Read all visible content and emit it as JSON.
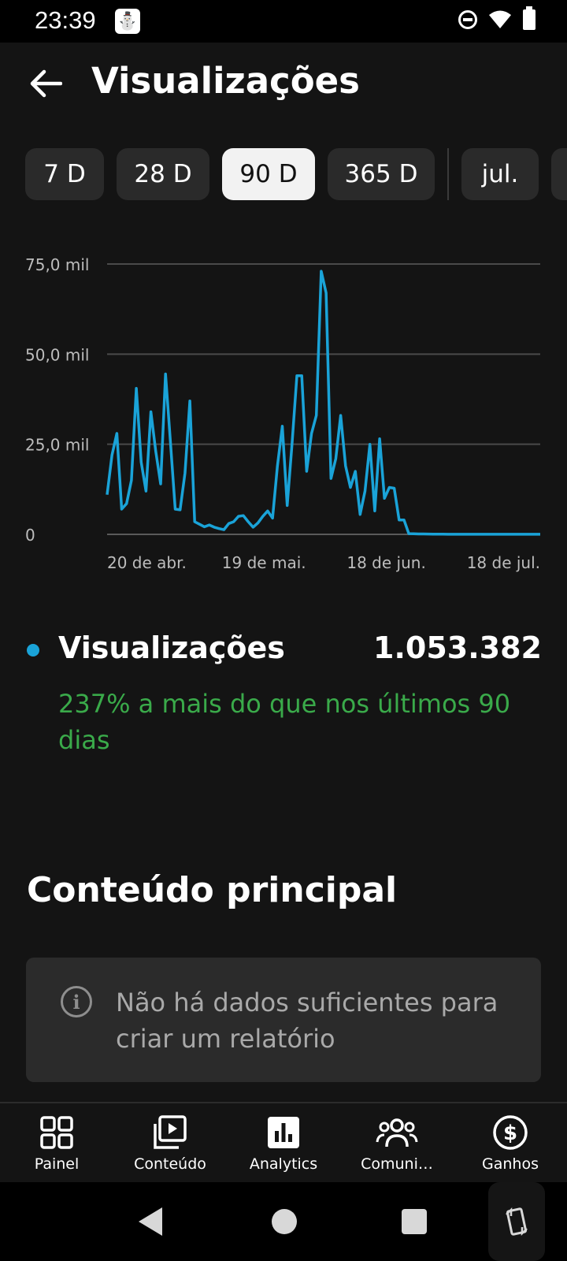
{
  "status": {
    "time": "23:39"
  },
  "header": {
    "title": "Visualizações"
  },
  "chips": [
    {
      "label": "7 D",
      "active": false
    },
    {
      "label": "28 D",
      "active": false
    },
    {
      "label": "90 D",
      "active": true
    },
    {
      "label": "365 D",
      "active": false
    },
    {
      "label": "jul.",
      "active": false
    }
  ],
  "chart_data": {
    "type": "line",
    "series": [
      {
        "color": "#1aa3d8",
        "values": [
          11000,
          22000,
          28000,
          7000,
          8500,
          15000,
          40500,
          20000,
          12000,
          34000,
          23000,
          14000,
          44500,
          26000,
          7000,
          6800,
          17000,
          37000,
          3500,
          2800,
          2100,
          2600,
          2000,
          1600,
          1300,
          3000,
          3500,
          5000,
          5200,
          3500,
          2000,
          3200,
          5000,
          6500,
          4500,
          19000,
          30000,
          8000,
          25000,
          44000,
          44000,
          17500,
          28000,
          33000,
          73000,
          67000,
          15500,
          21000,
          33000,
          19000,
          13000,
          17500,
          5500,
          12000,
          25000,
          6500,
          26500,
          10000,
          13000,
          12800,
          4000,
          4000,
          200,
          150,
          120,
          100,
          80,
          60,
          50,
          40,
          30,
          30,
          30,
          30,
          30,
          30,
          30,
          30,
          30,
          30,
          30,
          30,
          30,
          30,
          30,
          30,
          30,
          30,
          30,
          30
        ]
      }
    ],
    "y_ticks": [
      "0",
      "25,0 mil",
      "50,0 mil",
      "75,0 mil"
    ],
    "y_tick_values": [
      0,
      25000,
      50000,
      75000
    ],
    "x_ticks": [
      "20 de abr.",
      "19 de mai.",
      "18 de jun.",
      "18 de jul."
    ],
    "x_tick_indices": [
      0,
      29,
      59,
      89
    ],
    "ylim": [
      0,
      75000
    ],
    "grid": true
  },
  "legend": {
    "label": "Visualizações",
    "value": "1.053.382",
    "compare": "237% a mais do que nos últimos 90 dias",
    "dot_color": "#1aa3d8"
  },
  "top_content": {
    "title": "Conteúdo principal",
    "empty_message": "Não há dados suficientes para criar um relatório"
  },
  "bottom_nav": [
    {
      "label": "Painel",
      "icon": "dashboard-icon"
    },
    {
      "label": "Conteúdo",
      "icon": "content-icon"
    },
    {
      "label": "Analytics",
      "icon": "analytics-icon"
    },
    {
      "label": "Comuni…",
      "icon": "community-icon"
    },
    {
      "label": "Ganhos",
      "icon": "earnings-icon"
    }
  ]
}
